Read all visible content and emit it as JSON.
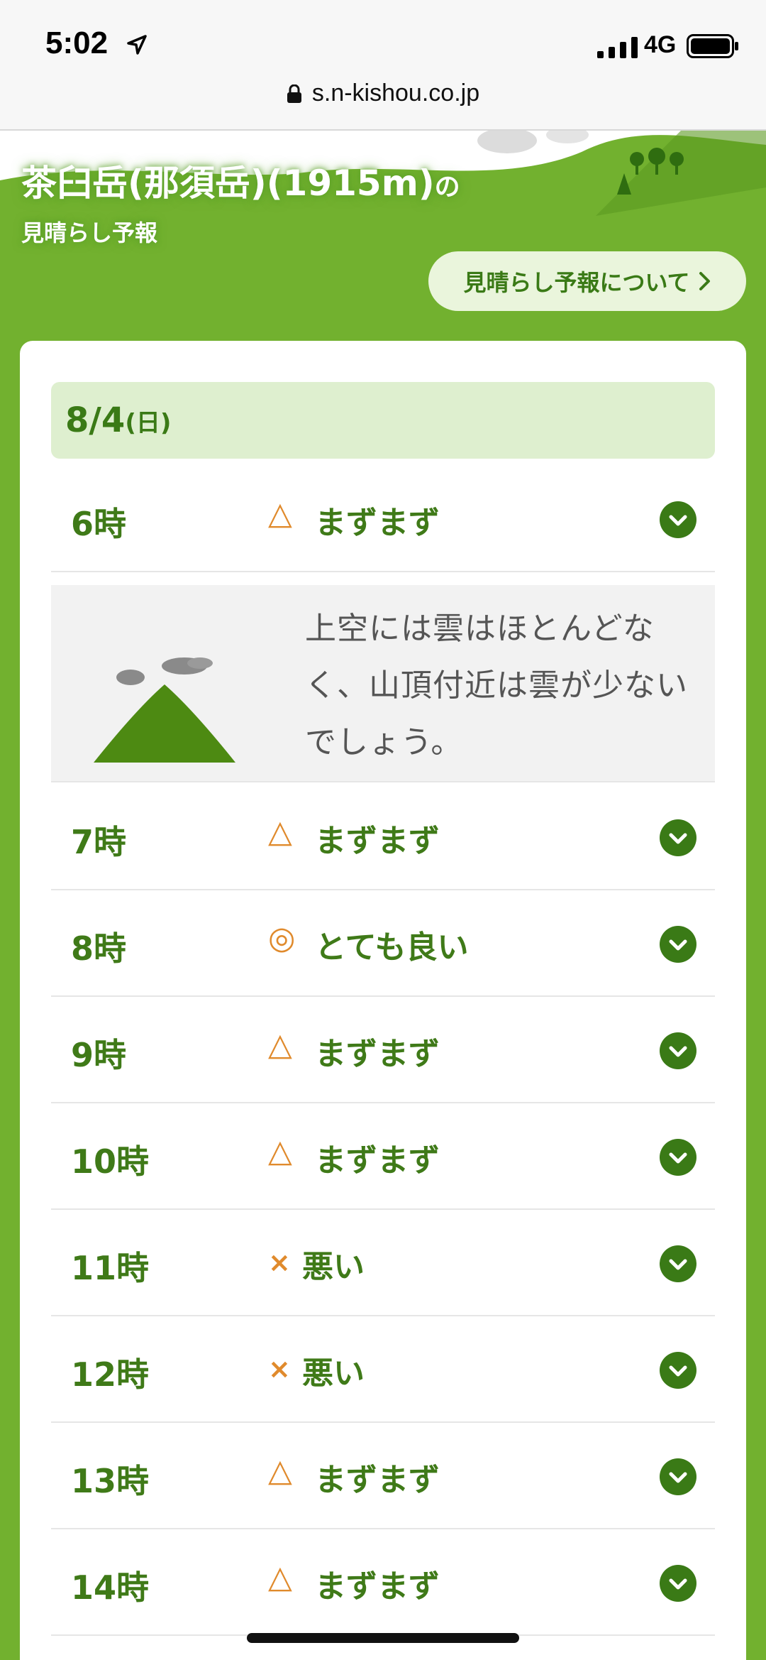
{
  "status_bar": {
    "time": "5:02",
    "network": "4G"
  },
  "browser": {
    "url": "s.n-kishou.co.jp"
  },
  "header": {
    "title_main": "茶臼岳(那須岳)(1915m)",
    "title_suffix": "の",
    "subtitle": "見晴らし予報",
    "about_button": "見晴らし予報について"
  },
  "forecast": {
    "date": "8/4",
    "day_of_week": "(日)",
    "detail_text": "上空には雲はほとんどなく、山頂付近は雲が少ないでしょう。",
    "rows": [
      {
        "hour": "6時",
        "mark": "△",
        "status": "まずまず"
      },
      {
        "hour": "7時",
        "mark": "△",
        "status": "まずまず"
      },
      {
        "hour": "8時",
        "mark": "◎",
        "status": "とても良い"
      },
      {
        "hour": "9時",
        "mark": "△",
        "status": "まずまず"
      },
      {
        "hour": "10時",
        "mark": "△",
        "status": "まずまず"
      },
      {
        "hour": "11時",
        "mark": "×",
        "status": "悪い"
      },
      {
        "hour": "12時",
        "mark": "×",
        "status": "悪い"
      },
      {
        "hour": "13時",
        "mark": "△",
        "status": "まずまず"
      },
      {
        "hour": "14時",
        "mark": "△",
        "status": "まずまず"
      }
    ]
  },
  "icons": {
    "location": "location-arrow-icon",
    "signal": "cellular-signal-icon",
    "battery": "battery-icon",
    "lock": "lock-icon",
    "chevron": "chevron-down-icon",
    "mountain": "mountain-cloud-icon"
  },
  "colors": {
    "brand_green": "#72b12f",
    "dark_green": "#3a7a16",
    "accent_orange": "#e08a2c",
    "date_bg": "#deefcf"
  }
}
